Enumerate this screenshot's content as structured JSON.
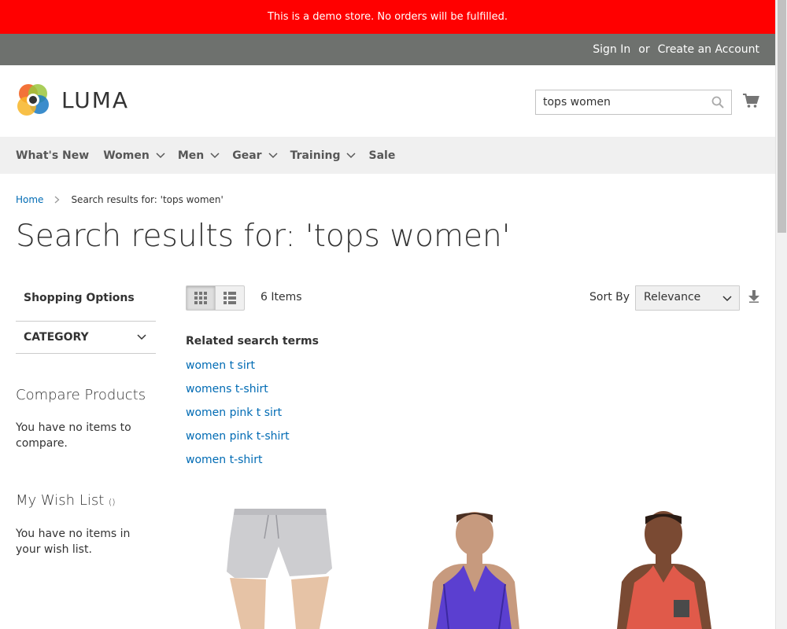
{
  "demo_notice": "This is a demo store. No orders will be fulfilled.",
  "header": {
    "sign_in": "Sign In",
    "or": "or",
    "create_account": "Create an Account",
    "logo_text": "LUMA",
    "search_value": "tops women"
  },
  "nav": {
    "items": [
      {
        "label": "What's New"
      },
      {
        "label": "Women"
      },
      {
        "label": "Men"
      },
      {
        "label": "Gear"
      },
      {
        "label": "Training"
      },
      {
        "label": "Sale"
      }
    ]
  },
  "breadcrumb": {
    "home": "Home",
    "current": "Search results for: 'tops women'"
  },
  "page_title": "Search results for: 'tops women'",
  "sidebar": {
    "shopping_options": "Shopping Options",
    "category_filter": "CATEGORY",
    "compare_title": "Compare Products",
    "compare_text": "You have no items to compare.",
    "wishlist_title": "My Wish List",
    "wishlist_count": "()",
    "wishlist_text": "You have no items in your wish list."
  },
  "toolbar": {
    "items_count": "6 Items",
    "sort_label": "Sort By",
    "sort_value": "Relevance"
  },
  "related": {
    "title": "Related search terms",
    "terms": [
      "women t sirt",
      "womens t-shirt",
      "women pink t sirt",
      "women pink t-shirt",
      "women t-shirt"
    ]
  },
  "colors": {
    "demo_bar": "#ff0000",
    "header_bar": "#6e716e",
    "link": "#006bb4",
    "nav_bg": "#f0f0f0"
  }
}
